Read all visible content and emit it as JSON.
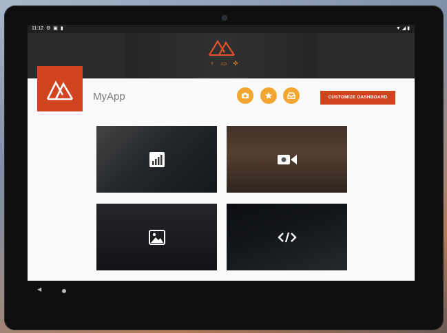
{
  "status_bar": {
    "time": "11:12",
    "left_icons": [
      "gear-icon",
      "notification-icon",
      "sd-card-icon"
    ],
    "right_icons": [
      "wifi-icon",
      "signal-icon",
      "battery-icon"
    ]
  },
  "header": {
    "logo": "mountain-logo-icon",
    "nav_icons": [
      "rocket-icon",
      "monitor-icon",
      "gamepad-icon"
    ]
  },
  "profile": {
    "app_name": "MyApp"
  },
  "actions": [
    {
      "icon": "camera-icon"
    },
    {
      "icon": "star-icon"
    },
    {
      "icon": "inbox-icon"
    }
  ],
  "customize_label": "CUSTOMIZE DASHBOARD",
  "tiles": [
    {
      "icon": "chart-icon"
    },
    {
      "icon": "video-icon"
    },
    {
      "icon": "image-icon"
    },
    {
      "icon": "code-icon"
    }
  ],
  "colors": {
    "accent_red": "#d0441f",
    "accent_orange": "#f2a531",
    "header_bg": "#2a2a2a"
  }
}
